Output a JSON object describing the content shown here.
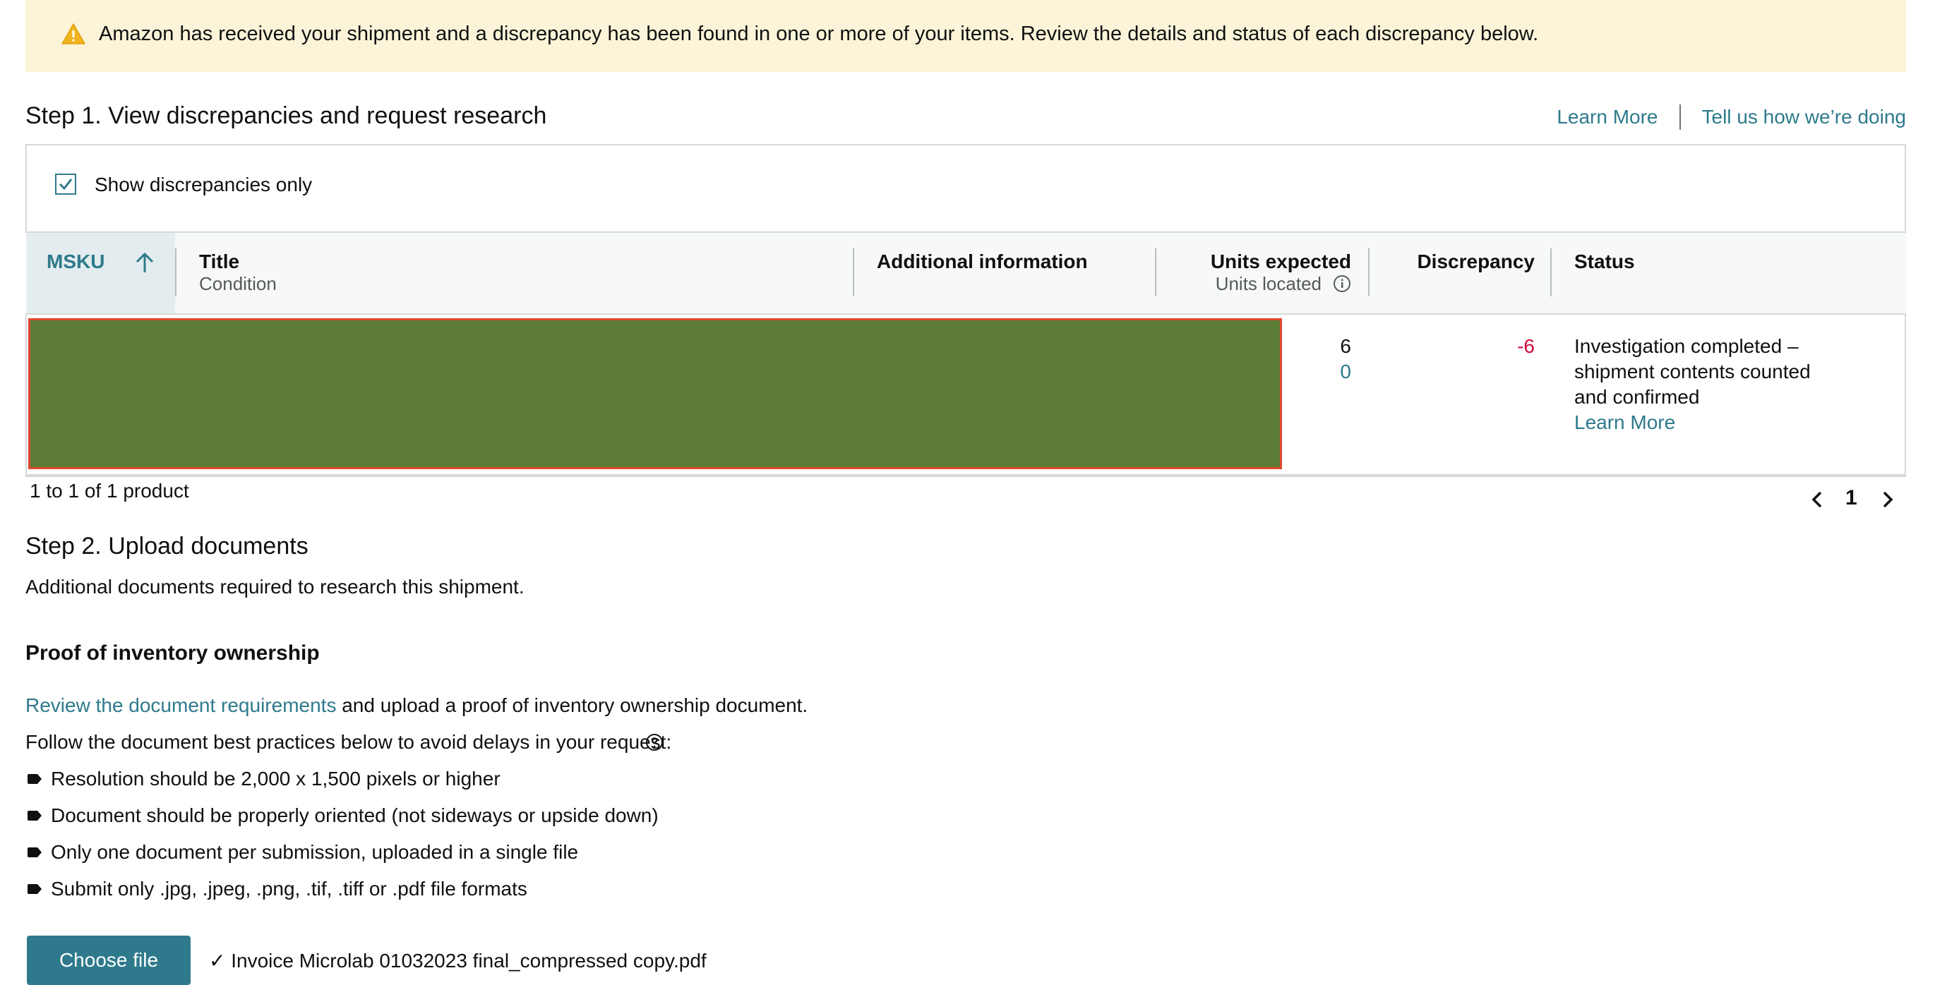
{
  "alert": {
    "icon": "warning-icon",
    "text": "Amazon has received your shipment and a discrepancy has been found in one or more of your items. Review the details and status of each discrepancy below."
  },
  "step1": {
    "title": "Step 1. View discrepancies and request research",
    "learn_more": "Learn More",
    "feedback": "Tell us how we’re doing",
    "checkbox_label": "Show discrepancies only",
    "checkbox_checked": true
  },
  "table": {
    "columns": {
      "msku": "MSKU",
      "title": "Title",
      "condition": "Condition",
      "additional": "Additional information",
      "units_expected": "Units expected",
      "units_located": "Units located",
      "discrepancy": "Discrepancy",
      "status": "Status"
    },
    "rows": [
      {
        "units_expected": "6",
        "units_located": "0",
        "discrepancy": "-6",
        "status_line1": "Investigation completed –",
        "status_line2": "shipment contents counted",
        "status_line3": "and confirmed",
        "status_link": "Learn More"
      }
    ],
    "pagination_summary": "1 to 1 of 1 product",
    "current_page": "1"
  },
  "step2": {
    "title": "Step 2. Upload documents",
    "subtitle": "Additional documents required to research this shipment.",
    "section_title": "Proof of inventory ownership",
    "review_link": "Review the document requirements",
    "review_rest": " and upload a proof of inventory ownership document.",
    "best_practices": "Follow the document best practices below to avoid delays in your request:",
    "bullets": [
      "Resolution should be 2,000 x 1,500 pixels or higher",
      "Document should be properly oriented (not sideways or upside down)",
      "Only one document per submission, uploaded in a single file",
      "Submit only .jpg, .jpeg, .png, .tif, .tiff or .pdf file formats"
    ],
    "choose_file": "Choose file",
    "file_name": "✓ Invoice Microlab 01032023 final_compressed copy.pdf"
  },
  "colors": {
    "link": "#2e7a8c",
    "alert_bg": "#fcf4d9",
    "discrepancy_negative": "#cc0c39",
    "redaction": "#5c7b35",
    "button": "#2e7a8c"
  }
}
